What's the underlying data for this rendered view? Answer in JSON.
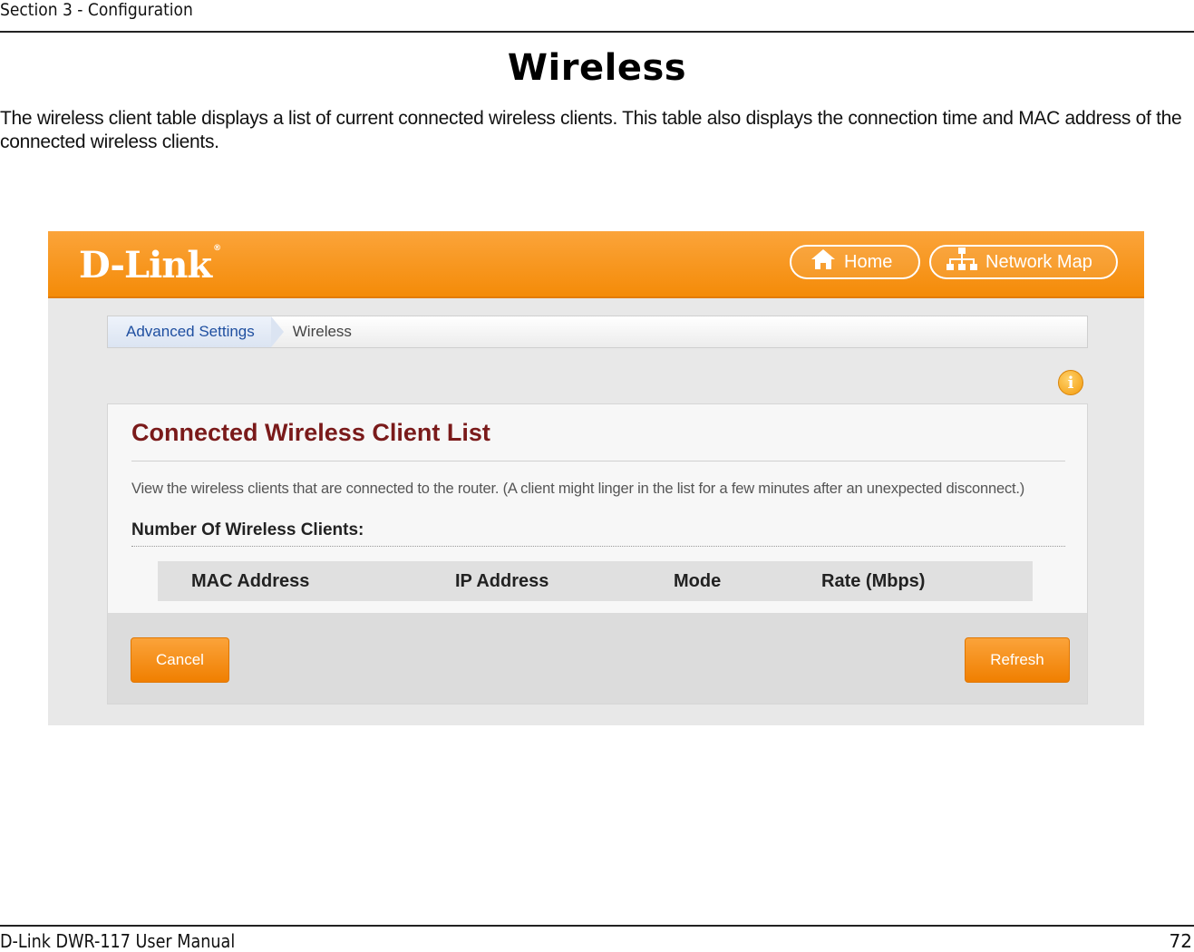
{
  "section_header": "Section 3 - Configuration",
  "page_heading": "Wireless",
  "intro_text": "The wireless client table displays a list of current connected wireless clients. This table also displays the connection time and MAC address of the connected wireless clients.",
  "router_ui": {
    "logo": "D-Link",
    "logo_mark": "®",
    "nav": {
      "home_label": "Home",
      "network_map_label": "Network Map"
    },
    "breadcrumb": {
      "parent": "Advanced Settings",
      "current": "Wireless"
    },
    "info_icon": "info-icon",
    "panel": {
      "title": "Connected Wireless Client List",
      "description": "View the wireless clients that are connected to the router. (A client might linger in the list for a few minutes after an unexpected disconnect.)",
      "count_label": "Number Of Wireless Clients:",
      "table_headers": [
        "MAC Address",
        "IP Address",
        "Mode",
        "Rate (Mbps)"
      ],
      "cancel_label": "Cancel",
      "refresh_label": "Refresh"
    },
    "colors": {
      "accent": "#f48b08",
      "title": "#7a1a1a",
      "link": "#1f4fa0"
    }
  },
  "footer": {
    "manual": "D-Link DWR-117 User Manual",
    "page_number": "72"
  }
}
